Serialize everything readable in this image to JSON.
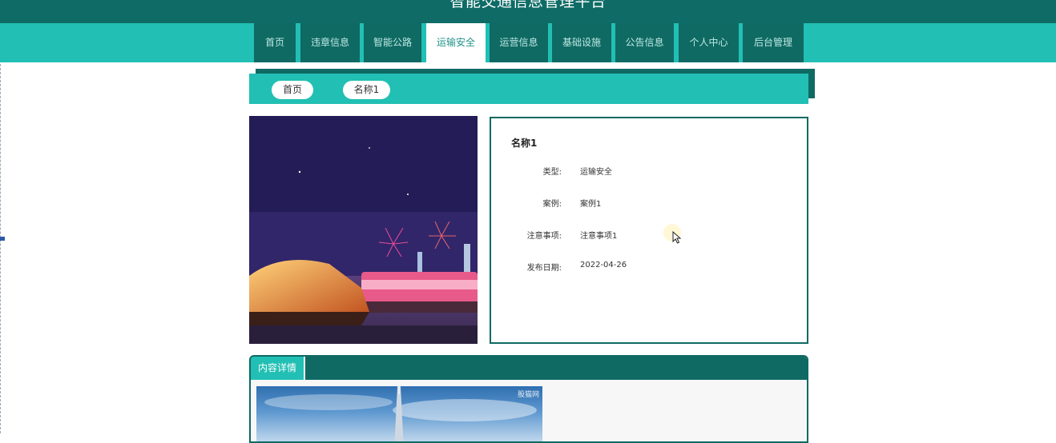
{
  "header": {
    "title": "智能交通信息管理平台"
  },
  "nav": {
    "items": [
      {
        "label": "首页"
      },
      {
        "label": "违章信息"
      },
      {
        "label": "智能公路"
      },
      {
        "label": "运输安全",
        "active": true
      },
      {
        "label": "运营信息"
      },
      {
        "label": "基础设施"
      },
      {
        "label": "公告信息"
      },
      {
        "label": "个人中心"
      },
      {
        "label": "后台管理"
      }
    ]
  },
  "breadcrumb": {
    "home": "首页",
    "current": "名称1"
  },
  "detail": {
    "name": "名称1",
    "fields": [
      {
        "label": "类型:",
        "value": "运输安全"
      },
      {
        "label": "案例:",
        "value": "案例1"
      },
      {
        "label": "注意事项:",
        "value": "注意事项1"
      },
      {
        "label": "发布日期:",
        "value": "2022-04-26"
      }
    ]
  },
  "content": {
    "tab_label": "内容详情",
    "image_watermark": "股猫网"
  },
  "colors": {
    "dark_teal": "#0f6a63",
    "teal": "#22bfb4",
    "white": "#ffffff"
  }
}
